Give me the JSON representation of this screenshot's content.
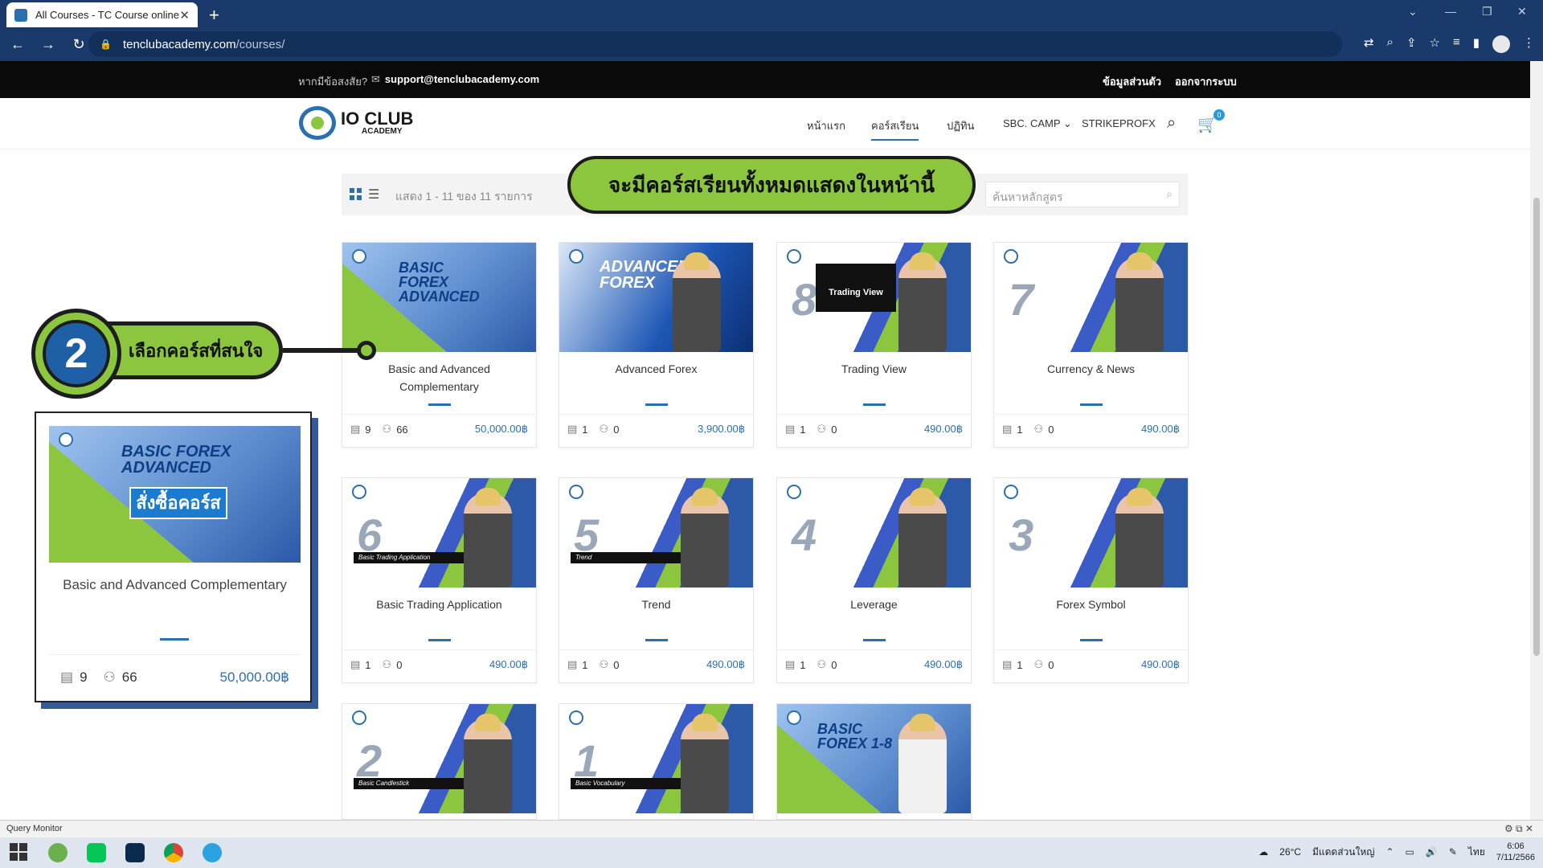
{
  "browser": {
    "tab_title": "All Courses - TC Course online",
    "url_host": "tenclubacademy.com",
    "url_path": "/courses/"
  },
  "topbar": {
    "question": "หากมีข้อสงสัย?",
    "email": "support@tenclubacademy.com",
    "profile": "ข้อมูลส่วนตัว",
    "logout": "ออกจากระบบ"
  },
  "header": {
    "logo_main": "IO CLUB",
    "logo_sub": "ACADEMY",
    "nav": [
      "หน้าแรก",
      "คอร์สเรียน",
      "ปฏิทิน",
      "SBC. CAMP",
      "STRIKEPROFX"
    ],
    "cart_count": "0"
  },
  "filter": {
    "showing": "แสดง 1 - 11 ของ 11 รายการ",
    "search_placeholder": "ค้นหาหลักสูตร"
  },
  "annotations": {
    "callout_top": "จะมีคอร์สเรียนทั้งหมดแสดงในหน้านี้",
    "step_number": "2",
    "step_label": "เลือกคอร์สที่สนใจ",
    "zoom_order_label": "สั่งซื้อคอร์ส",
    "zoom_title": "Basic and Advanced Complementary",
    "zoom_lessons": "9",
    "zoom_students": "66",
    "zoom_price": "50,000.00฿"
  },
  "courses": [
    {
      "title": "Basic and Advanced Complementary",
      "lessons": "9",
      "students": "66",
      "price": "50,000.00฿",
      "thumb_text": "BASIC FOREX ADVANCED"
    },
    {
      "title": "Advanced Forex",
      "lessons": "1",
      "students": "0",
      "price": "3,900.00฿",
      "thumb_text": "ADVANCED FOREX"
    },
    {
      "title": "Trading View",
      "lessons": "1",
      "students": "0",
      "price": "490.00฿",
      "thumb_text": "Trading View",
      "num": "8"
    },
    {
      "title": "Currency & News",
      "lessons": "1",
      "students": "0",
      "price": "490.00฿",
      "num": "7"
    },
    {
      "title": "Basic Trading Application",
      "lessons": "1",
      "students": "0",
      "price": "490.00฿",
      "num": "6",
      "strip": "Basic Trading Application"
    },
    {
      "title": "Trend",
      "lessons": "1",
      "students": "0",
      "price": "490.00฿",
      "num": "5",
      "strip": "Trend"
    },
    {
      "title": "Leverage",
      "lessons": "1",
      "students": "0",
      "price": "490.00฿",
      "num": "4"
    },
    {
      "title": "Forex Symbol",
      "lessons": "1",
      "students": "0",
      "price": "490.00฿",
      "num": "3"
    },
    {
      "title": "",
      "num": "2",
      "strip": "Basic Candlestick"
    },
    {
      "title": "",
      "num": "1",
      "strip": "Basic Vocabulary"
    },
    {
      "title": "",
      "thumb_text": "BASIC FOREX 1-8"
    }
  ],
  "status": {
    "query_monitor": "Query Monitor",
    "weather": "26°C",
    "weather_text": "มีแดดส่วนใหญ่",
    "lang": "ไทย",
    "time": "6:06",
    "date": "7/11/2566"
  }
}
